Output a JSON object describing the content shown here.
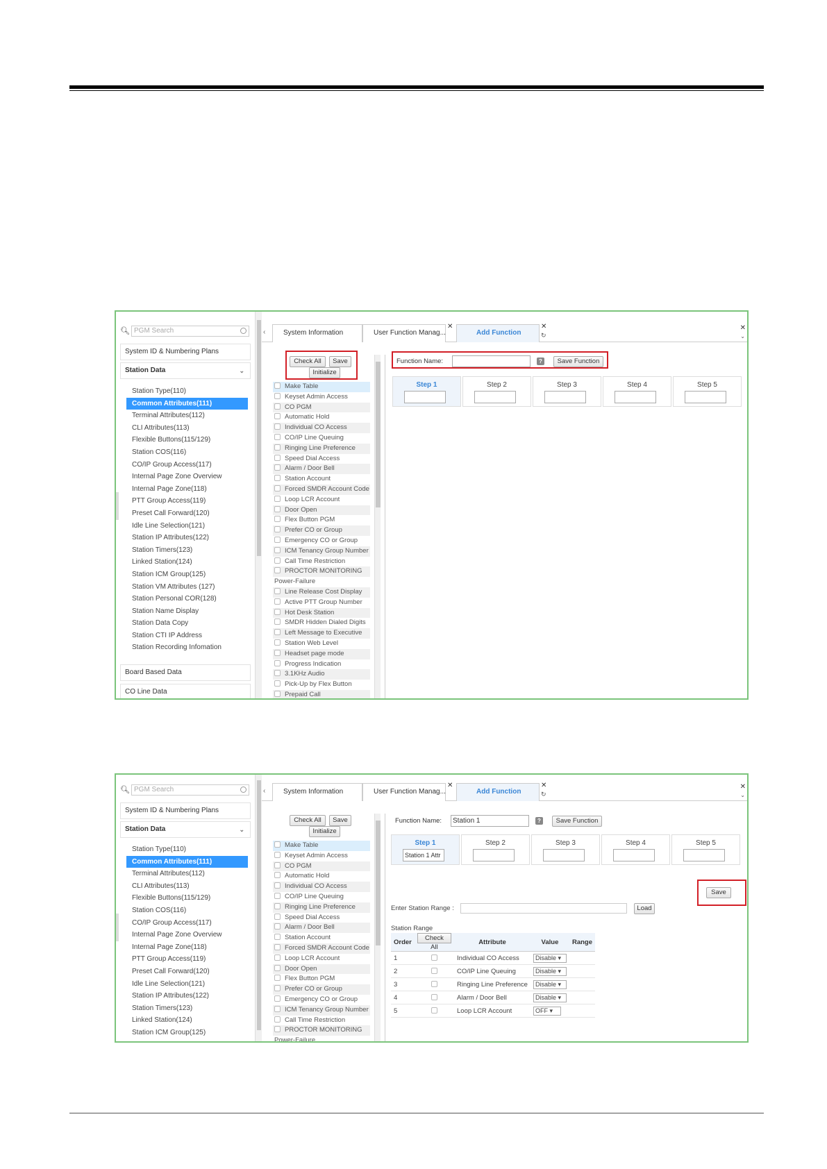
{
  "menu": {
    "search_placeholder": "PGM Search",
    "group_system": "System ID & Numbering Plans",
    "group_station": "Station Data",
    "group_board": "Board Based Data",
    "group_co": "CO Line Data",
    "items": [
      "Station Type(110)",
      "Common Attributes(111)",
      "Terminal Attributes(112)",
      "CLI Attributes(113)",
      "Flexible Buttons(115/129)",
      "Station COS(116)",
      "CO/IP Group Access(117)",
      "Internal Page Zone Overview",
      "Internal Page Zone(118)",
      "PTT Group Access(119)",
      "Preset Call Forward(120)",
      "Idle Line Selection(121)",
      "Station IP Attributes(122)",
      "Station Timers(123)",
      "Linked Station(124)",
      "Station ICM Group(125)",
      "Station VM Attributes (127)",
      "Station Personal COR(128)",
      "Station Name Display",
      "Station Data Copy",
      "Station CTI IP Address",
      "Station Recording Infomation"
    ]
  },
  "tabs": {
    "system_information": "System Information",
    "user_function": "User Function Manag...",
    "add_function": "Add Function"
  },
  "buttons": {
    "check_all": "Check All",
    "save": "Save",
    "initialize": "Initialize",
    "save_function": "Save Function",
    "load": "Load"
  },
  "functions": [
    "Make Table",
    "Keyset Admin Access",
    "CO PGM",
    "Automatic Hold",
    "Individual CO Access",
    "CO/IP Line Queuing",
    "Ringing Line Preference",
    "Speed Dial Access",
    "Alarm / Door Bell",
    "Station Account",
    "Forced SMDR Account Code",
    "Loop LCR Account",
    "Door Open",
    "Flex Button PGM",
    "Prefer CO or Group",
    "Emergency CO or Group",
    "ICM Tenancy Group Number",
    "Call Time Restriction",
    "PROCTOR MONITORING",
    "Power-Failure",
    "Line Release Cost Display",
    "Active PTT Group Number",
    "Hot Desk Station",
    "SMDR Hidden Dialed Digits",
    "Left Message to Executive",
    "Station Web Level",
    "Headset page mode",
    "Progress Indication",
    "3.1KHz Audio",
    "Pick-Up by Flex Button",
    "Prepaid Call"
  ],
  "function_name": {
    "label": "Function Name:",
    "help": "?",
    "value2": "Station 1"
  },
  "steps": [
    "Step 1",
    "Step 2",
    "Step 3",
    "Step 4",
    "Step 5"
  ],
  "step1_value2": "Station 1 Attr",
  "range": {
    "enter_label": "Enter Station Range :",
    "station_range_label": "Station Range"
  },
  "table": {
    "headers": [
      "Order",
      "Check All",
      "Attribute",
      "Value",
      "Range"
    ],
    "rows": [
      {
        "order": "1",
        "attribute": "Individual CO Access",
        "value": "Disable"
      },
      {
        "order": "2",
        "attribute": "CO/IP Line Queuing",
        "value": "Disable"
      },
      {
        "order": "3",
        "attribute": "Ringing Line Preference",
        "value": "Disable"
      },
      {
        "order": "4",
        "attribute": "Alarm / Door Bell",
        "value": "Disable"
      },
      {
        "order": "5",
        "attribute": "Loop LCR Account",
        "value": "OFF"
      }
    ]
  },
  "colors": {
    "highlight": "#d21f26",
    "active": "#3399ff",
    "frame": "#7bc47b"
  }
}
